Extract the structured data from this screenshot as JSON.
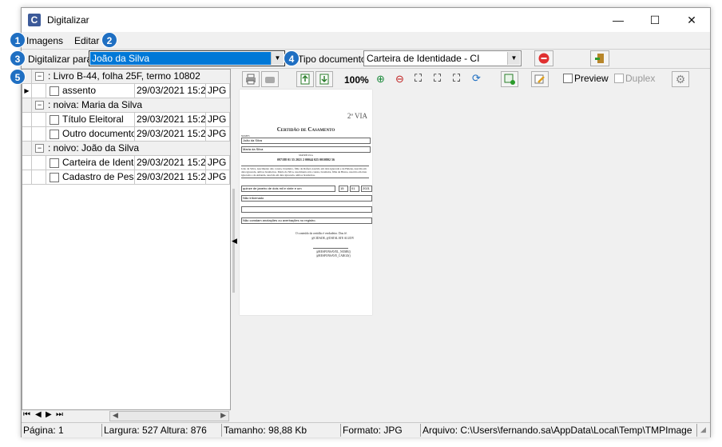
{
  "window": {
    "title": "Digitalizar",
    "minimize": "—",
    "maximize": "☐",
    "close": "✕"
  },
  "menu": {
    "items": [
      "Imagens",
      "Editar"
    ]
  },
  "toolbar": {
    "scan_to_label": "Digitalizar para:",
    "scan_to_value": "João da Silva",
    "doc_type_label": "Tipo documento:",
    "doc_type_value": "Carteira de Identidade - CI",
    "zoom": "100%",
    "preview_label": "Preview",
    "duplex_label": "Duplex"
  },
  "badges": [
    "1",
    "2",
    "3",
    "4",
    "5"
  ],
  "tree": {
    "rows": [
      {
        "kind": "group",
        "label": ": Livro B-44, folha 25F, termo 10802"
      },
      {
        "kind": "item",
        "name": "assento",
        "date": "29/03/2021 15:2",
        "type": "JPG",
        "selected": true
      },
      {
        "kind": "group",
        "label": ": noiva: Maria da Silva"
      },
      {
        "kind": "item",
        "name": "Título Eleitoral",
        "date": "29/03/2021 15:2",
        "type": "JPG"
      },
      {
        "kind": "item",
        "name": "Outro documento",
        "date": "29/03/2021 15:2",
        "type": "JPG"
      },
      {
        "kind": "group",
        "label": ": noivo: João da Silva"
      },
      {
        "kind": "item",
        "name": "Carteira de Identid",
        "date": "29/03/2021 15:2",
        "type": "JPG"
      },
      {
        "kind": "item",
        "name": "Cadastro de Pessc",
        "date": "29/03/2021 15:2",
        "type": "JPG"
      }
    ]
  },
  "document": {
    "via": "2ª VIA",
    "title": "Certidão de Casamento",
    "field_label_1": "NOMES",
    "name1": "João da Silva",
    "name2": "Maria da Silva",
    "matricula_label": "MATRÍCULA",
    "matricula": "097188 01 55 2021 2 00044 025 0010802 56",
    "body": "João da Silva, nascimento não consta, brasileiro, filho de Rafael, nascido em data ignorada e de Helena, nascida em data ignorada, ambos brasileiros. Maria da Silva, nascimento não consta, brasileira, filha de Bruno, nascido em data ignorada e de Amanda, nascida em data ignorada, ambos brasileiros.",
    "date_text": "quinze de janeiro de dois mil e vinte e um",
    "day": "15",
    "month": "01",
    "year": "2021",
    "regime": "Não informado",
    "notes": "Não constam anotações ou averbações no registro.",
    "footer1": "O conteúdo da certidão é verdadeiro. Dou fé.",
    "footer2": "@CIDADE, @DATALATE ALUDY",
    "footer3": "@RESPONSAVEL_NOME()",
    "footer4": "@RESPONSAVE_CARGO()"
  },
  "status": {
    "page": "Página: 1",
    "dims": "Largura: 527 Altura: 876",
    "size": "Tamanho: 98,88 Kb",
    "format": "Formato: JPG",
    "file": "Arquivo: C:\\Users\\fernando.sa\\AppData\\Local\\Temp\\TMPImage"
  },
  "colors": {
    "selection": "#0078d7",
    "badge": "#1f6fc2",
    "stop": "#e03030"
  }
}
